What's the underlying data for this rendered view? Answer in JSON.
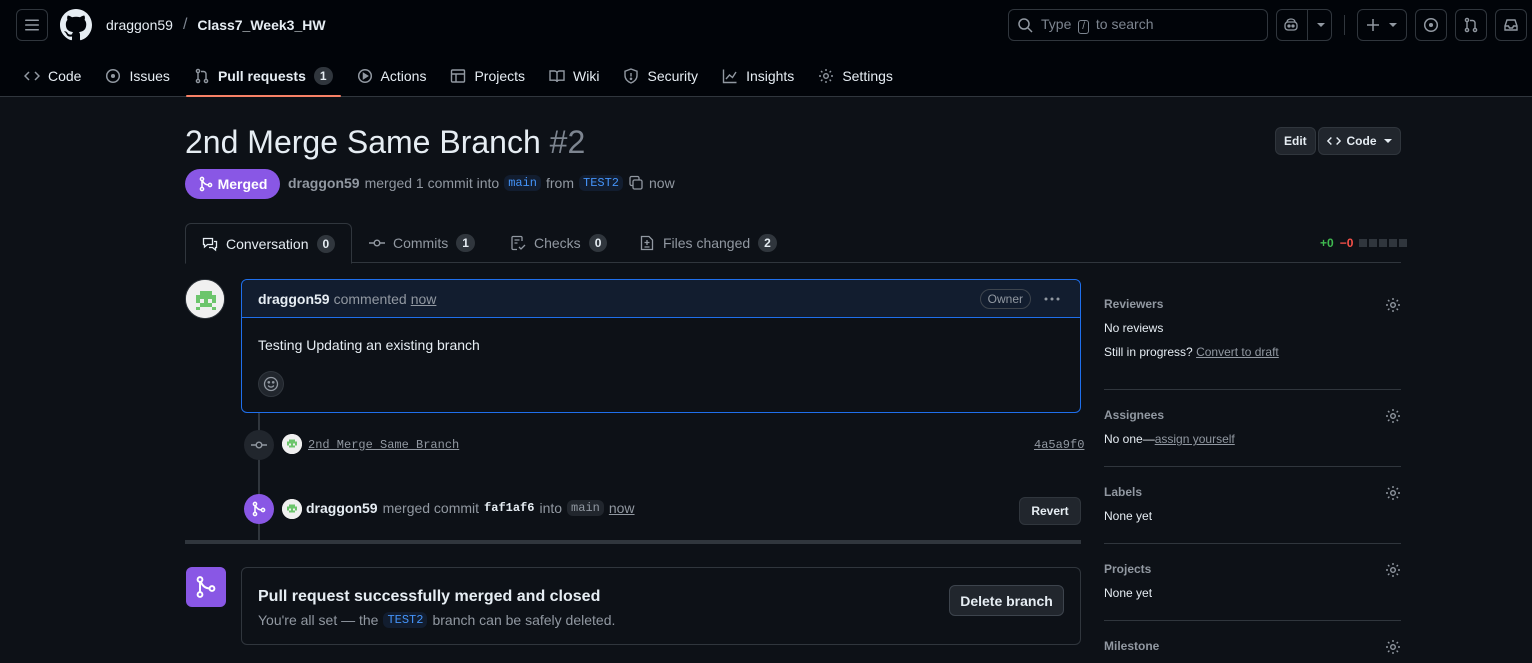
{
  "header": {
    "owner": "draggon59",
    "separator": "/",
    "repo": "Class7_Week3_HW",
    "search_prefix": "Type",
    "search_key": "/",
    "search_suffix": "to search"
  },
  "nav": [
    {
      "label": "Code",
      "icon": "code-icon"
    },
    {
      "label": "Issues",
      "icon": "issue-icon"
    },
    {
      "label": "Pull requests",
      "icon": "pull-request-icon",
      "count": "1",
      "active": true
    },
    {
      "label": "Actions",
      "icon": "play-icon"
    },
    {
      "label": "Projects",
      "icon": "table-icon"
    },
    {
      "label": "Wiki",
      "icon": "book-icon"
    },
    {
      "label": "Security",
      "icon": "shield-icon"
    },
    {
      "label": "Insights",
      "icon": "graph-icon"
    },
    {
      "label": "Settings",
      "icon": "gear-icon"
    }
  ],
  "pr": {
    "title": "2nd Merge Same Branch",
    "number": "#2",
    "edit_label": "Edit",
    "code_label": "Code",
    "state": "Merged",
    "author": "draggon59",
    "merged_text": "merged 1 commit into",
    "base": "main",
    "from_text": "from",
    "head": "TEST2",
    "time": "now"
  },
  "tabs": [
    {
      "label": "Conversation",
      "count": "0",
      "active": true
    },
    {
      "label": "Commits",
      "count": "1"
    },
    {
      "label": "Checks",
      "count": "0"
    },
    {
      "label": "Files changed",
      "count": "2"
    }
  ],
  "diffstat": {
    "additions": "+0",
    "deletions": "−0"
  },
  "comment": {
    "author": "draggon59",
    "action": "commented",
    "time": "now",
    "role": "Owner",
    "body": "Testing Updating an existing branch"
  },
  "commit_event": {
    "message": "2nd Merge Same Branch",
    "sha": "4a5a9f0"
  },
  "merge_event": {
    "author": "draggon59",
    "text": "merged commit",
    "sha": "faf1af6",
    "into": "into",
    "branch": "main",
    "time": "now",
    "revert_label": "Revert"
  },
  "merged_box": {
    "title": "Pull request successfully merged and closed",
    "pre": "You're all set — the",
    "branch": "TEST2",
    "post": "branch can be safely deleted.",
    "button": "Delete branch"
  },
  "sidebar": {
    "reviewers": {
      "heading": "Reviewers",
      "value": "No reviews",
      "progress": "Still in progress?",
      "link": "Convert to draft"
    },
    "assignees": {
      "heading": "Assignees",
      "value": "No one—",
      "link": "assign yourself"
    },
    "labels": {
      "heading": "Labels",
      "value": "None yet"
    },
    "projects": {
      "heading": "Projects",
      "value": "None yet"
    },
    "milestone": {
      "heading": "Milestone"
    }
  },
  "colors": {
    "accent_merged": "#8957e5",
    "link_blue": "#4493f8",
    "tab_underline": "#f78166"
  }
}
